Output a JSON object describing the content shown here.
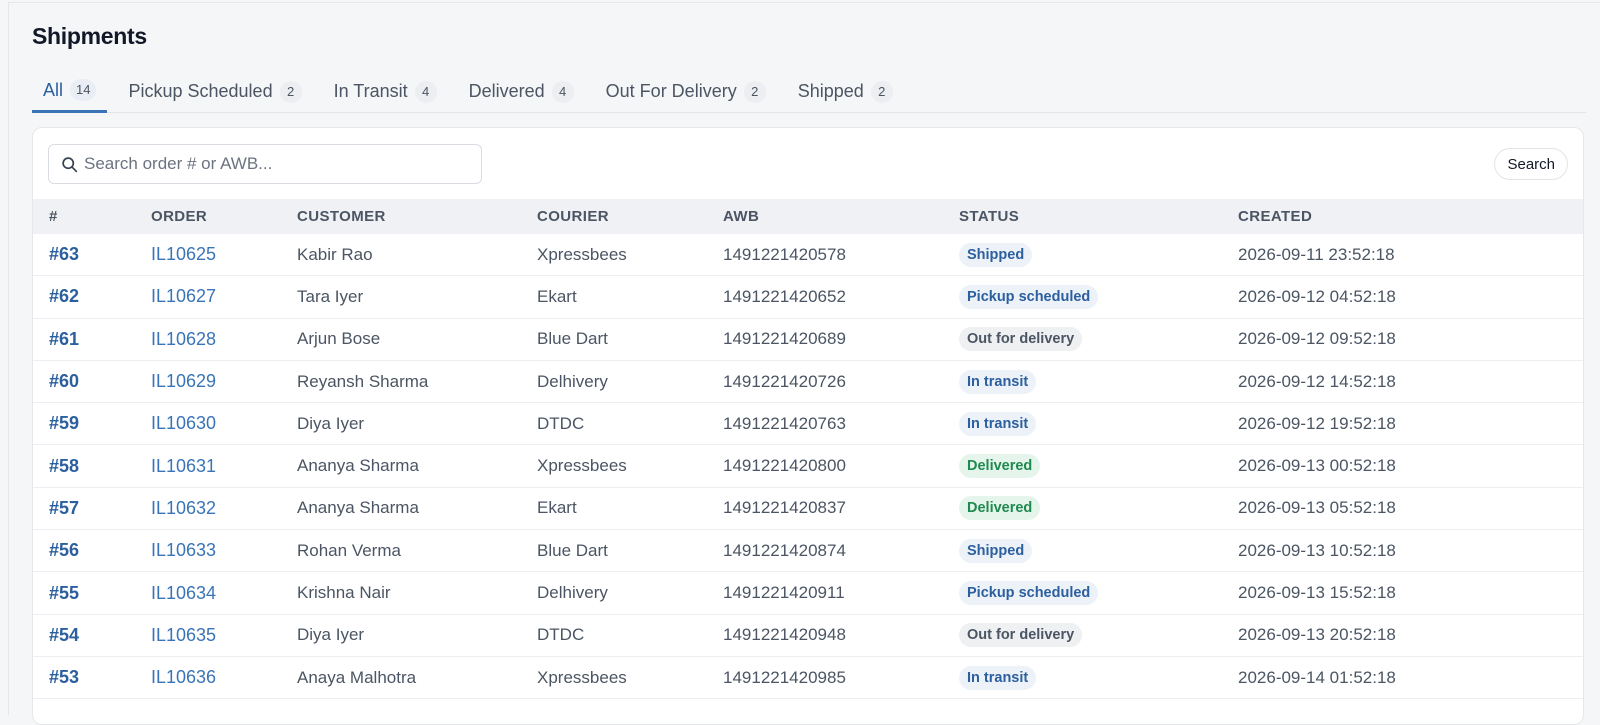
{
  "page": {
    "title": "Shipments"
  },
  "tabs": [
    {
      "label": "All",
      "count": "14",
      "active": true
    },
    {
      "label": "Pickup Scheduled",
      "count": "2"
    },
    {
      "label": "In Transit",
      "count": "4"
    },
    {
      "label": "Delivered",
      "count": "4"
    },
    {
      "label": "Out For Delivery",
      "count": "2"
    },
    {
      "label": "Shipped",
      "count": "2"
    }
  ],
  "search": {
    "placeholder": "Search order # or AWB...",
    "value": "",
    "button_label": "Search"
  },
  "table": {
    "columns": [
      "#",
      "ORDER",
      "CUSTOMER",
      "COURIER",
      "AWB",
      "STATUS",
      "CREATED"
    ],
    "rows": [
      {
        "id": "#63",
        "order": "IL10625",
        "customer": "Kabir Rao",
        "courier": "Xpressbees",
        "awb": "1491221420578",
        "status": "Shipped",
        "status_tone": "blue",
        "created": "2026-09-11 23:52:18"
      },
      {
        "id": "#62",
        "order": "IL10627",
        "customer": "Tara Iyer",
        "courier": "Ekart",
        "awb": "1491221420652",
        "status": "Pickup scheduled",
        "status_tone": "blue",
        "created": "2026-09-12 04:52:18"
      },
      {
        "id": "#61",
        "order": "IL10628",
        "customer": "Arjun Bose",
        "courier": "Blue Dart",
        "awb": "1491221420689",
        "status": "Out for delivery",
        "status_tone": "gray",
        "created": "2026-09-12 09:52:18"
      },
      {
        "id": "#60",
        "order": "IL10629",
        "customer": "Reyansh Sharma",
        "courier": "Delhivery",
        "awb": "1491221420726",
        "status": "In transit",
        "status_tone": "blue",
        "created": "2026-09-12 14:52:18"
      },
      {
        "id": "#59",
        "order": "IL10630",
        "customer": "Diya Iyer",
        "courier": "DTDC",
        "awb": "1491221420763",
        "status": "In transit",
        "status_tone": "blue",
        "created": "2026-09-12 19:52:18"
      },
      {
        "id": "#58",
        "order": "IL10631",
        "customer": "Ananya Sharma",
        "courier": "Xpressbees",
        "awb": "1491221420800",
        "status": "Delivered",
        "status_tone": "green",
        "created": "2026-09-13 00:52:18"
      },
      {
        "id": "#57",
        "order": "IL10632",
        "customer": "Ananya Sharma",
        "courier": "Ekart",
        "awb": "1491221420837",
        "status": "Delivered",
        "status_tone": "green",
        "created": "2026-09-13 05:52:18"
      },
      {
        "id": "#56",
        "order": "IL10633",
        "customer": "Rohan Verma",
        "courier": "Blue Dart",
        "awb": "1491221420874",
        "status": "Shipped",
        "status_tone": "blue",
        "created": "2026-09-13 10:52:18"
      },
      {
        "id": "#55",
        "order": "IL10634",
        "customer": "Krishna Nair",
        "courier": "Delhivery",
        "awb": "1491221420911",
        "status": "Pickup scheduled",
        "status_tone": "blue",
        "created": "2026-09-13 15:52:18"
      },
      {
        "id": "#54",
        "order": "IL10635",
        "customer": "Diya Iyer",
        "courier": "DTDC",
        "awb": "1491221420948",
        "status": "Out for delivery",
        "status_tone": "gray",
        "created": "2026-09-13 20:52:18"
      },
      {
        "id": "#53",
        "order": "IL10636",
        "customer": "Anaya Malhotra",
        "courier": "Xpressbees",
        "awb": "1491221420985",
        "status": "In transit",
        "status_tone": "blue",
        "created": "2026-09-14 01:52:18"
      }
    ]
  },
  "colors": {
    "accent": "#2b5f9e",
    "link": "#3a74b8",
    "delivered": "#1e8a4f"
  }
}
